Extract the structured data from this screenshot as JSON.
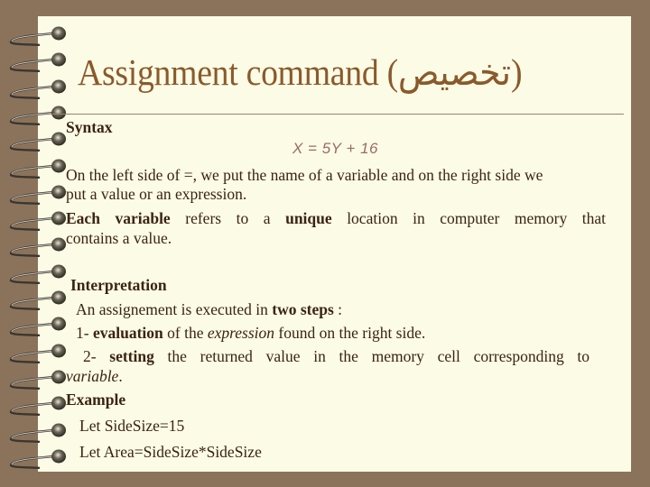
{
  "slide": {
    "title": "Assignment command (تخصيص)",
    "colors": {
      "background": "#8b735b",
      "paper": "#fcfbe6",
      "title": "#8a5a2b",
      "body_text": "#3a2410",
      "formula": "#9a6b6b"
    },
    "syntax": {
      "heading": "Syntax",
      "formula": "X = 5Y + 16",
      "para1_line1": "On the left side of =, we put the name of a variable and on the right side we",
      "para1_line2": "put a value or an expression.",
      "para2": {
        "each_variable": "Each variable",
        "refers_to_a": " refers to a ",
        "unique": "unique",
        "rest_line1": " location in computer memory that",
        "line2": "contains a value."
      }
    },
    "interpretation": {
      "heading": "Interpretation",
      "line1_prefix": "An assignement is executed in ",
      "line1_bold": "two steps",
      "line1_suffix": " :",
      "step1_num": "1- ",
      "step1_bold": "evaluation",
      "step1_mid": " of the ",
      "step1_italic": "expression",
      "step1_suffix": " found on the right side.",
      "step2_num": "2- ",
      "step2_bold": "setting",
      "step2_rest": " the returned value in the memory cell corresponding to",
      "step2_line2": "variable",
      "step2_line2_end": "."
    },
    "example": {
      "heading": "Example",
      "lines": [
        "Let SideSize=15",
        "Let Area=SideSize*SideSize"
      ]
    }
  }
}
